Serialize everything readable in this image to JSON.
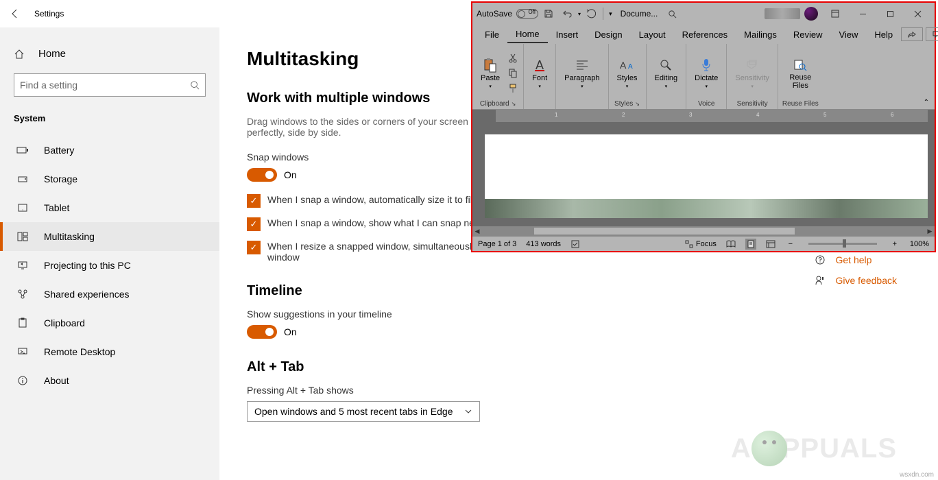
{
  "settings": {
    "header": "Settings",
    "home": "Home",
    "search_placeholder": "Find a setting",
    "category": "System",
    "nav": [
      {
        "label": "Battery",
        "icon": "battery"
      },
      {
        "label": "Storage",
        "icon": "storage"
      },
      {
        "label": "Tablet",
        "icon": "tablet"
      },
      {
        "label": "Multitasking",
        "icon": "multitask",
        "selected": true
      },
      {
        "label": "Projecting to this PC",
        "icon": "project"
      },
      {
        "label": "Shared experiences",
        "icon": "shared"
      },
      {
        "label": "Clipboard",
        "icon": "clipboard"
      },
      {
        "label": "Remote Desktop",
        "icon": "remote"
      },
      {
        "label": "About",
        "icon": "about"
      }
    ]
  },
  "main": {
    "title": "Multitasking",
    "section1_title": "Work with multiple windows",
    "section1_desc": "Drag windows to the sides or corners of your screen and they'll automatically size to fit perfectly, side by side.",
    "snap_label": "Snap windows",
    "snap_state": "On",
    "checks": [
      "When I snap a window, automatically size it to fill available space",
      "When I snap a window, show what I can snap next to it",
      "When I resize a snapped window, simultaneously resize any adjacent snapped window"
    ],
    "timeline_title": "Timeline",
    "timeline_label": "Show suggestions in your timeline",
    "timeline_state": "On",
    "alttab_title": "Alt + Tab",
    "alttab_label": "Pressing Alt + Tab shows",
    "alttab_value": "Open windows and 5 most recent tabs in Edge"
  },
  "help": {
    "get_help": "Get help",
    "feedback": "Give feedback"
  },
  "word": {
    "autosave_label": "AutoSave",
    "autosave_state": "Off",
    "doc_name": "Docume...",
    "menu": [
      "File",
      "Home",
      "Insert",
      "Design",
      "Layout",
      "References",
      "Mailings",
      "Review",
      "View",
      "Help"
    ],
    "menu_active": "Home",
    "ribbon": {
      "clipboard": {
        "label": "Clipboard",
        "paste": "Paste"
      },
      "font": {
        "label": "Font"
      },
      "paragraph": {
        "label": "Paragraph"
      },
      "styles": {
        "label": "Styles",
        "btn": "Styles"
      },
      "editing": {
        "label": "Editing"
      },
      "dictate": {
        "label": "Voice",
        "btn": "Dictate"
      },
      "sensitivity": {
        "label": "Sensitivity",
        "btn": "Sensitivity"
      },
      "reuse": {
        "label": "Reuse Files",
        "btn": "Reuse Files"
      }
    },
    "ruler_marks": [
      "1",
      "2",
      "3",
      "4",
      "5",
      "6"
    ],
    "status": {
      "page": "Page 1 of 3",
      "words": "413 words",
      "focus": "Focus",
      "zoom": "100%"
    }
  },
  "watermark": "PPUALS",
  "credit": "wsxdn.com"
}
